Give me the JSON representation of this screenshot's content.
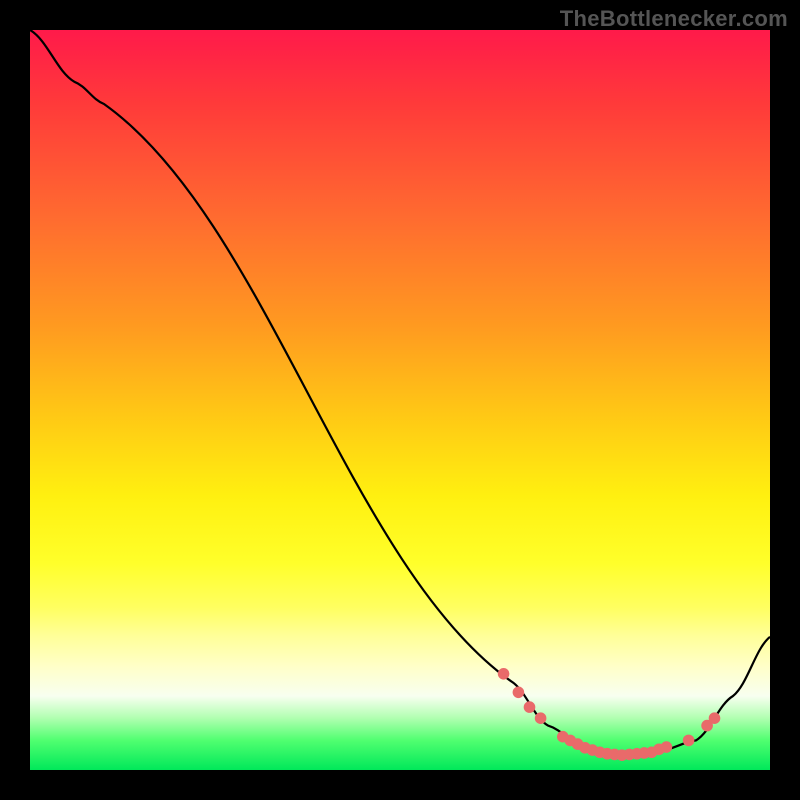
{
  "source_label": "TheBottlenecker.com",
  "chart_data": {
    "type": "line",
    "title": "",
    "xlabel": "",
    "ylabel": "",
    "xlim": [
      0,
      100
    ],
    "ylim": [
      0,
      100
    ],
    "curve": [
      {
        "x": 0,
        "y": 100
      },
      {
        "x": 6,
        "y": 93
      },
      {
        "x": 10,
        "y": 90
      },
      {
        "x": 65,
        "y": 12
      },
      {
        "x": 70,
        "y": 6
      },
      {
        "x": 75,
        "y": 3
      },
      {
        "x": 80,
        "y": 2
      },
      {
        "x": 85,
        "y": 2.5
      },
      {
        "x": 90,
        "y": 4
      },
      {
        "x": 95,
        "y": 10
      },
      {
        "x": 100,
        "y": 18
      }
    ],
    "markers": [
      {
        "x": 64,
        "y": 13
      },
      {
        "x": 66,
        "y": 10.5
      },
      {
        "x": 67.5,
        "y": 8.5
      },
      {
        "x": 69,
        "y": 7
      },
      {
        "x": 72,
        "y": 4.5
      },
      {
        "x": 73,
        "y": 4
      },
      {
        "x": 74,
        "y": 3.5
      },
      {
        "x": 75,
        "y": 3
      },
      {
        "x": 76,
        "y": 2.7
      },
      {
        "x": 77,
        "y": 2.4
      },
      {
        "x": 78,
        "y": 2.2
      },
      {
        "x": 79,
        "y": 2.1
      },
      {
        "x": 80,
        "y": 2
      },
      {
        "x": 81,
        "y": 2.1
      },
      {
        "x": 82,
        "y": 2.2
      },
      {
        "x": 83,
        "y": 2.3
      },
      {
        "x": 84,
        "y": 2.4
      },
      {
        "x": 85,
        "y": 2.8
      },
      {
        "x": 86,
        "y": 3.1
      },
      {
        "x": 89,
        "y": 4
      },
      {
        "x": 91.5,
        "y": 6
      },
      {
        "x": 92.5,
        "y": 7
      }
    ],
    "marker_color": "#e96a6a",
    "curve_color": "#000000"
  }
}
